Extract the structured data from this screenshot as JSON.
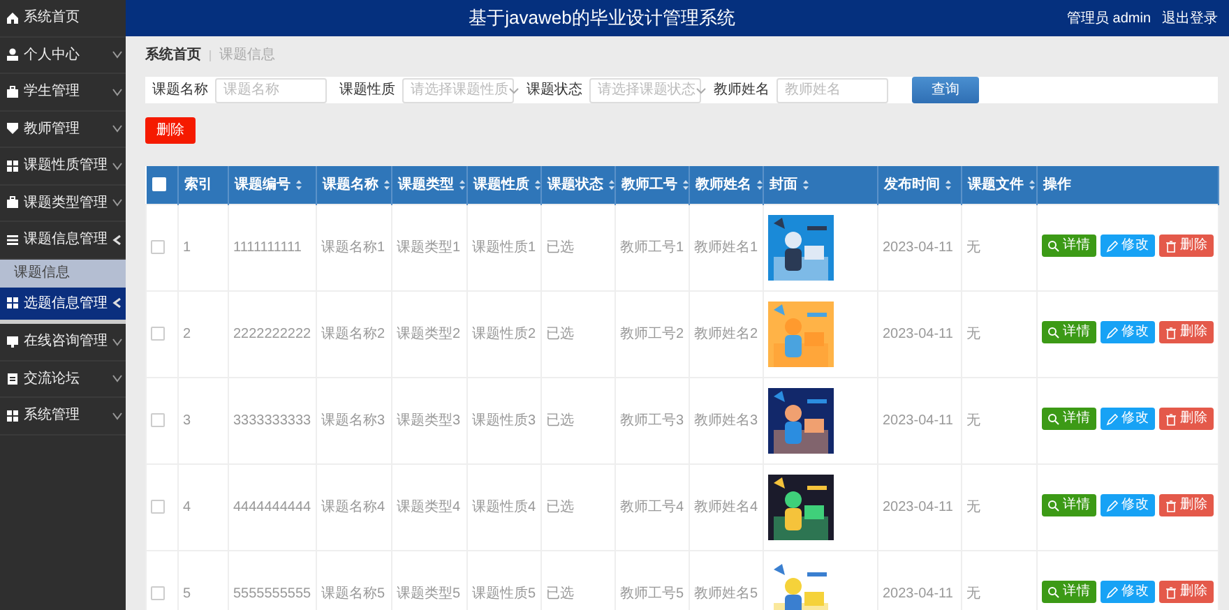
{
  "header": {
    "title": "基于javaweb的毕业设计管理系统",
    "user": "管理员 admin",
    "logout": "退出登录"
  },
  "sidebar": {
    "items": [
      {
        "label": "系统首页",
        "kind": "home",
        "selected": false
      },
      {
        "label": "个人中心",
        "kind": "user",
        "expanded": false,
        "selected": false
      },
      {
        "label": "学生管理",
        "kind": "case",
        "expanded": false,
        "selected": false
      },
      {
        "label": "教师管理",
        "kind": "shield",
        "expanded": false,
        "selected": false
      },
      {
        "label": "课题性质管理",
        "kind": "grid",
        "expanded": false,
        "selected": false
      },
      {
        "label": "课题类型管理",
        "kind": "case",
        "expanded": false,
        "selected": false
      },
      {
        "label": "课题信息管理",
        "kind": "list",
        "expanded": true,
        "selected": false,
        "children": [
          {
            "label": "课题信息",
            "selected": true
          }
        ]
      },
      {
        "label": "选题信息管理",
        "kind": "grid",
        "expanded": true,
        "selected": true
      },
      {
        "label": "在线咨询管理",
        "kind": "monitor",
        "expanded": false,
        "selected": false
      },
      {
        "label": "交流论坛",
        "kind": "clip",
        "expanded": false,
        "selected": false
      },
      {
        "label": "系统管理",
        "kind": "grid",
        "expanded": false,
        "selected": false
      }
    ]
  },
  "breadcrumb": [
    "系统首页",
    "课题信息"
  ],
  "filters": [
    {
      "label": "课题名称",
      "kind": "input",
      "placeholder": "课题名称"
    },
    {
      "label": "课题性质",
      "kind": "select",
      "placeholder": "请选择课题性质"
    },
    {
      "label": "课题状态",
      "kind": "select",
      "placeholder": "请选择课题状态"
    },
    {
      "label": "教师姓名",
      "kind": "input",
      "placeholder": "教师姓名"
    }
  ],
  "search_button": "查询",
  "delete_button": "删除",
  "table": {
    "select_all": false,
    "columns": [
      {
        "label": "索引",
        "sortable": false
      },
      {
        "label": "课题编号",
        "sortable": true
      },
      {
        "label": "课题名称",
        "sortable": true
      },
      {
        "label": "课题类型",
        "sortable": true
      },
      {
        "label": "课题性质",
        "sortable": true
      },
      {
        "label": "课题状态",
        "sortable": true
      },
      {
        "label": "教师工号",
        "sortable": true
      },
      {
        "label": "教师姓名",
        "sortable": true
      },
      {
        "label": "封面",
        "sortable": true
      },
      {
        "label": "发布时间",
        "sortable": true
      },
      {
        "label": "课题文件",
        "sortable": true
      },
      {
        "label": "操作",
        "sortable": false
      }
    ],
    "rows": [
      {
        "checked": false,
        "cells": [
          "1",
          "1111111111",
          "课题名称1",
          "课题类型1",
          "课题性质1",
          "已选",
          "教师工号1",
          "教师姓名1"
        ],
        "cover": {
          "kind": "picture"
        },
        "date": "2023-04-11",
        "file": "无",
        "actions": [
          {
            "label": "详情",
            "kind": "detail"
          },
          {
            "label": "修改",
            "kind": "edit"
          },
          {
            "label": "删除",
            "kind": "delete"
          }
        ]
      },
      {
        "checked": false,
        "cells": [
          "2",
          "2222222222",
          "课题名称2",
          "课题类型2",
          "课题性质2",
          "已选",
          "教师工号2",
          "教师姓名2"
        ],
        "cover": {
          "kind": "picture"
        },
        "date": "2023-04-11",
        "file": "无",
        "actions": [
          {
            "label": "详情",
            "kind": "detail"
          },
          {
            "label": "修改",
            "kind": "edit"
          },
          {
            "label": "删除",
            "kind": "delete"
          }
        ]
      },
      {
        "checked": false,
        "cells": [
          "3",
          "3333333333",
          "课题名称3",
          "课题类型3",
          "课题性质3",
          "已选",
          "教师工号3",
          "教师姓名3"
        ],
        "cover": {
          "kind": "picture"
        },
        "date": "2023-04-11",
        "file": "无",
        "actions": [
          {
            "label": "详情",
            "kind": "detail"
          },
          {
            "label": "修改",
            "kind": "edit"
          },
          {
            "label": "删除",
            "kind": "delete"
          }
        ]
      },
      {
        "checked": false,
        "cells": [
          "4",
          "4444444444",
          "课题名称4",
          "课题类型4",
          "课题性质4",
          "已选",
          "教师工号4",
          "教师姓名4"
        ],
        "cover": {
          "kind": "picture"
        },
        "date": "2023-04-11",
        "file": "无",
        "actions": [
          {
            "label": "详情",
            "kind": "detail"
          },
          {
            "label": "修改",
            "kind": "edit"
          },
          {
            "label": "删除",
            "kind": "delete"
          }
        ]
      },
      {
        "checked": false,
        "cells": [
          "5",
          "5555555555",
          "课题名称5",
          "课题类型5",
          "课题性质5",
          "已选",
          "教师工号5",
          "教师姓名5"
        ],
        "cover": {
          "kind": "picture"
        },
        "date": "2023-04-11",
        "file": "无",
        "actions": [
          {
            "label": "详情",
            "kind": "detail"
          },
          {
            "label": "修改",
            "kind": "edit"
          },
          {
            "label": "删除",
            "kind": "delete"
          }
        ]
      }
    ]
  }
}
